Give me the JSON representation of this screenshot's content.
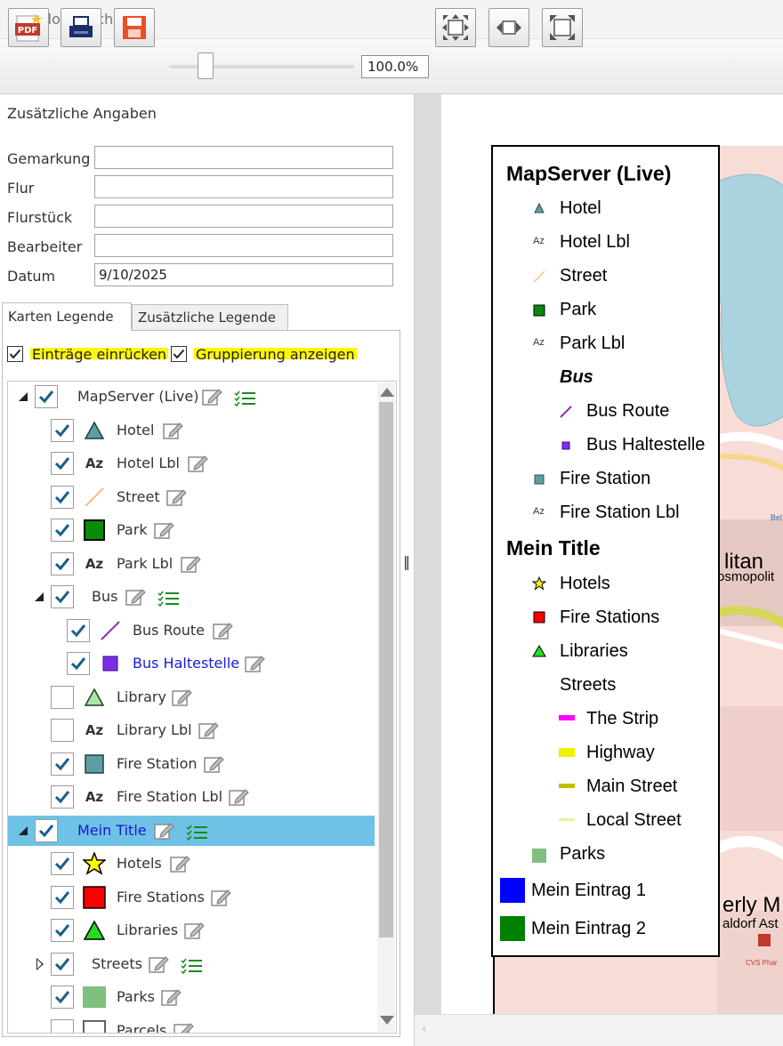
{
  "window": {
    "title": "Plotvorschau"
  },
  "toolbar": {
    "zoom_value": "100.0%"
  },
  "form": {
    "section_title": "Zusätzliche Angaben",
    "fields": [
      {
        "label": "Gemarkung",
        "value": ""
      },
      {
        "label": "Flur",
        "value": ""
      },
      {
        "label": "Flurstück",
        "value": ""
      },
      {
        "label": "Bearbeiter",
        "value": ""
      },
      {
        "label": "Datum",
        "value": "9/10/2025"
      }
    ]
  },
  "tabs": {
    "active": "Karten Legende",
    "inactive": "Zusätzliche Legende"
  },
  "options": {
    "indent_label": "Einträge einrücken",
    "group_label": "Gruppierung anzeigen",
    "indent_checked": true,
    "group_checked": true
  },
  "tree": {
    "items": [
      {
        "label": "MapServer (Live)",
        "checked": true
      },
      {
        "label": "Hotel",
        "checked": true
      },
      {
        "label": "Hotel Lbl",
        "checked": true
      },
      {
        "label": "Street",
        "checked": true
      },
      {
        "label": "Park",
        "checked": true
      },
      {
        "label": "Park Lbl",
        "checked": true
      },
      {
        "label": "Bus",
        "checked": true
      },
      {
        "label": "Bus Route",
        "checked": true
      },
      {
        "label": "Bus Haltestelle",
        "checked": true
      },
      {
        "label": "Library",
        "checked": false
      },
      {
        "label": "Library Lbl",
        "checked": false
      },
      {
        "label": "Fire Station",
        "checked": true
      },
      {
        "label": "Fire Station Lbl",
        "checked": true
      },
      {
        "label": "Mein Title",
        "checked": true
      },
      {
        "label": "Hotels",
        "checked": true
      },
      {
        "label": "Fire Stations",
        "checked": true
      },
      {
        "label": "Libraries",
        "checked": true
      },
      {
        "label": "Streets",
        "checked": true
      },
      {
        "label": "Parks",
        "checked": true
      },
      {
        "label": "Parcels",
        "checked": false
      }
    ]
  },
  "legend": {
    "group1_title": "MapServer (Live)",
    "hotel": "Hotel",
    "hotel_lbl": "Hotel Lbl",
    "street": "Street",
    "park": "Park",
    "park_lbl": "Park Lbl",
    "bus": "Bus",
    "bus_route": "Bus Route",
    "bus_stop": "Bus Haltestelle",
    "fire_station": "Fire Station",
    "fire_station_lbl": "Fire Station Lbl",
    "group2_title": "Mein Title",
    "hotels": "Hotels",
    "fire_stations": "Fire Stations",
    "libraries": "Libraries",
    "streets": "Streets",
    "strip": "The Strip",
    "highway": "Highway",
    "main_street": "Main Street",
    "local_street": "Local Street",
    "parks": "Parks",
    "entry1": "Mein Eintrag 1",
    "entry2": "Mein Eintrag 2",
    "az_glyph": "Az"
  },
  "map": {
    "label_1": "litan",
    "label_2": "osmopolit",
    "label_3": "erly M",
    "label_4": "aldorf Ast",
    "label_5": "Bel",
    "label_6": "CVS Phar"
  },
  "colors": {
    "selection": "#6ec2e6",
    "highlight": "#fff700",
    "check": "#1a5f8c"
  }
}
